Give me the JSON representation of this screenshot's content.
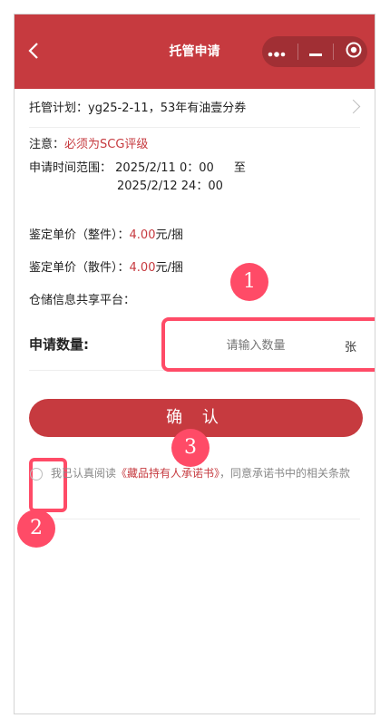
{
  "header": {
    "title": "托管申请"
  },
  "form": {
    "plan_label": "托管计划：",
    "plan_value": "yg25-2-11，53年有油壹分券",
    "note_label": "注意：",
    "note_value": "必须为SCG评级",
    "time_label": "申请时间范围：",
    "time_start": "2025/2/11  0：00",
    "time_to": "至",
    "time_end": "2025/2/12 24：00",
    "price_whole_label": "鉴定单价（整件）：",
    "price_whole_value": "4.00",
    "price_whole_unit": "元/捆",
    "price_loose_label": "鉴定单价（散件）：",
    "price_loose_value": "4.00",
    "price_loose_unit": "元/捆",
    "platform_label": "仓储信息共享平台：",
    "qty_label": "申请数量:",
    "qty_placeholder": "请输入数量",
    "qty_unit": "张"
  },
  "actions": {
    "confirm_label": "确 认"
  },
  "agreement": {
    "prefix": "我已认真阅读",
    "link": "《藏品持有人承诺书》",
    "suffix": "，同意承诺书中的相关条款"
  },
  "markers": [
    "1",
    "2",
    "3"
  ],
  "colors": {
    "primary": "#c63a3f",
    "marker": "#ff4b67"
  }
}
